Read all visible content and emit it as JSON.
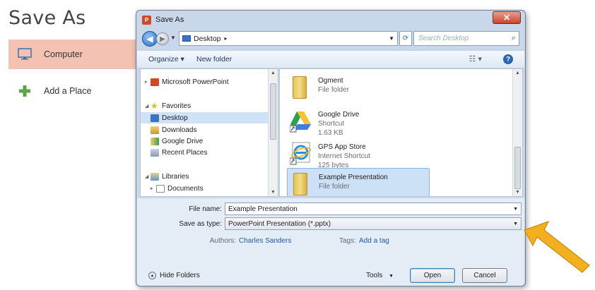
{
  "backstage": {
    "title": "Save As",
    "items": [
      {
        "label": "Computer",
        "icon": "computer-icon",
        "selected": true
      },
      {
        "label": "Add a Place",
        "icon": "plus-icon",
        "selected": false
      }
    ]
  },
  "dialog": {
    "title": "Save As",
    "close_glyph": "✕",
    "address": {
      "location": "Desktop"
    },
    "search_placeholder": "Search Desktop",
    "toolbar": {
      "organize": "Organize ▾",
      "new_folder": "New folder"
    },
    "nav_pane": {
      "items": [
        {
          "label": "Microsoft PowerPoint",
          "icon": "powerpoint-icon"
        },
        {
          "label": "Favorites",
          "icon": "star-icon"
        },
        {
          "label": "Desktop",
          "icon": "desktop-icon",
          "selected": true
        },
        {
          "label": "Downloads",
          "icon": "downloads-icon"
        },
        {
          "label": "Google Drive",
          "icon": "google-drive-icon"
        },
        {
          "label": "Recent Places",
          "icon": "recent-places-icon"
        },
        {
          "label": "Libraries",
          "icon": "libraries-icon"
        },
        {
          "label": "Documents",
          "icon": "documents-icon"
        }
      ]
    },
    "files": [
      {
        "name": "Ogment",
        "sub1": "File folder",
        "sub2": "",
        "icon": "folder-icon"
      },
      {
        "name": "Google Drive",
        "sub1": "Shortcut",
        "sub2": "1.63 KB",
        "icon": "google-drive-shortcut-icon"
      },
      {
        "name": "GPS App Store",
        "sub1": "Internet Shortcut",
        "sub2": "125 bytes",
        "icon": "internet-explorer-icon"
      },
      {
        "name": "Example Presentation",
        "sub1": "File folder",
        "sub2": "",
        "icon": "folder-icon",
        "selected": true
      }
    ],
    "form": {
      "file_name_label": "File name:",
      "file_name_value": "Example Presentation",
      "save_as_type_label": "Save as type:",
      "save_as_type_value": "PowerPoint Presentation (*.pptx)",
      "authors_label": "Authors:",
      "authors_value": "Charles Sanders",
      "tags_label": "Tags:",
      "tags_value": "Add a tag"
    },
    "footer": {
      "hide_folders": "Hide Folders",
      "tools": "Tools",
      "open": "Open",
      "cancel": "Cancel"
    }
  },
  "colors": {
    "accent_selected": "#f4c2b2",
    "arrow": "#f2b01e",
    "dialog_frame": "#c8d8ea"
  }
}
